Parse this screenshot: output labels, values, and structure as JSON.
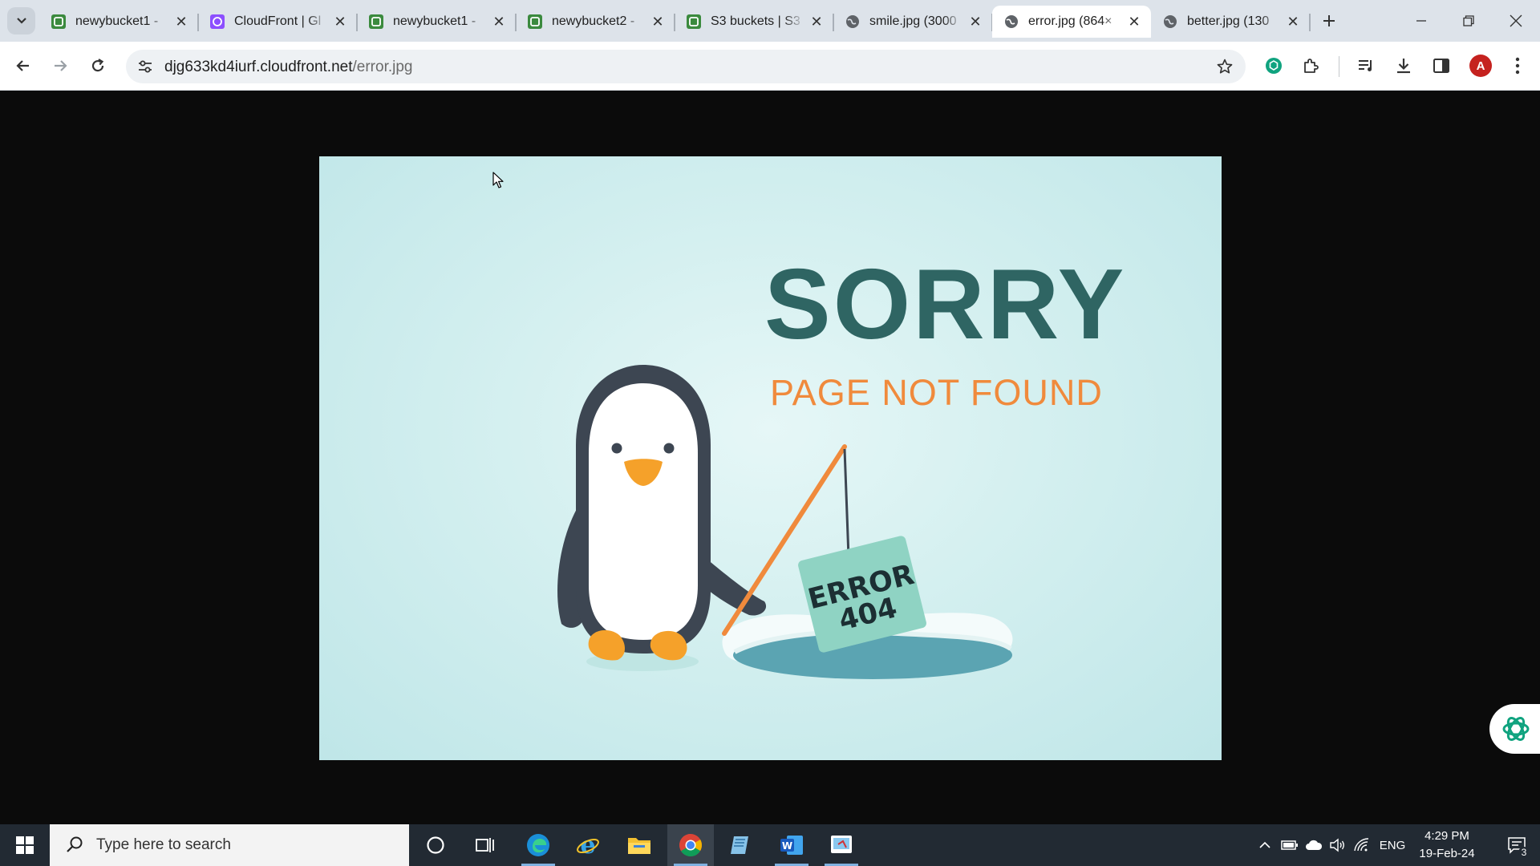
{
  "browser": {
    "tabs": [
      {
        "label": "newybucket1 - ",
        "icon": "aws-s3-favicon-icon",
        "active": false
      },
      {
        "label": "CloudFront | Gl",
        "icon": "cloudfront-favicon-icon",
        "active": false
      },
      {
        "label": "newybucket1 - ",
        "icon": "aws-s3-favicon-icon",
        "active": false
      },
      {
        "label": "newybucket2 - ",
        "icon": "aws-s3-favicon-icon",
        "active": false
      },
      {
        "label": "S3 buckets | S3",
        "icon": "aws-s3-favicon-icon",
        "active": false
      },
      {
        "label": "smile.jpg (3000",
        "icon": "globe-icon",
        "active": false
      },
      {
        "label": "error.jpg (864×",
        "icon": "globe-icon",
        "active": true
      },
      {
        "label": "better.jpg (130",
        "icon": "globe-icon",
        "active": false
      }
    ],
    "address": {
      "host": "djg633kd4iurf.cloudfront.net",
      "path": "/error.jpg"
    },
    "profile_initial": "A"
  },
  "image": {
    "headline": "SORRY",
    "subheadline": "PAGE NOT FOUND",
    "sign_line1": "ERROR",
    "sign_line2": "404"
  },
  "taskbar": {
    "search_placeholder": "Type here to search",
    "language": "ENG",
    "time": "4:29 PM",
    "date": "19-Feb-24",
    "notification_count": "3"
  },
  "colors": {
    "headline": "#2f6563",
    "subheadline": "#f08a3c",
    "image_background": "#d5f0f0",
    "profile_avatar": "#c5221f"
  }
}
